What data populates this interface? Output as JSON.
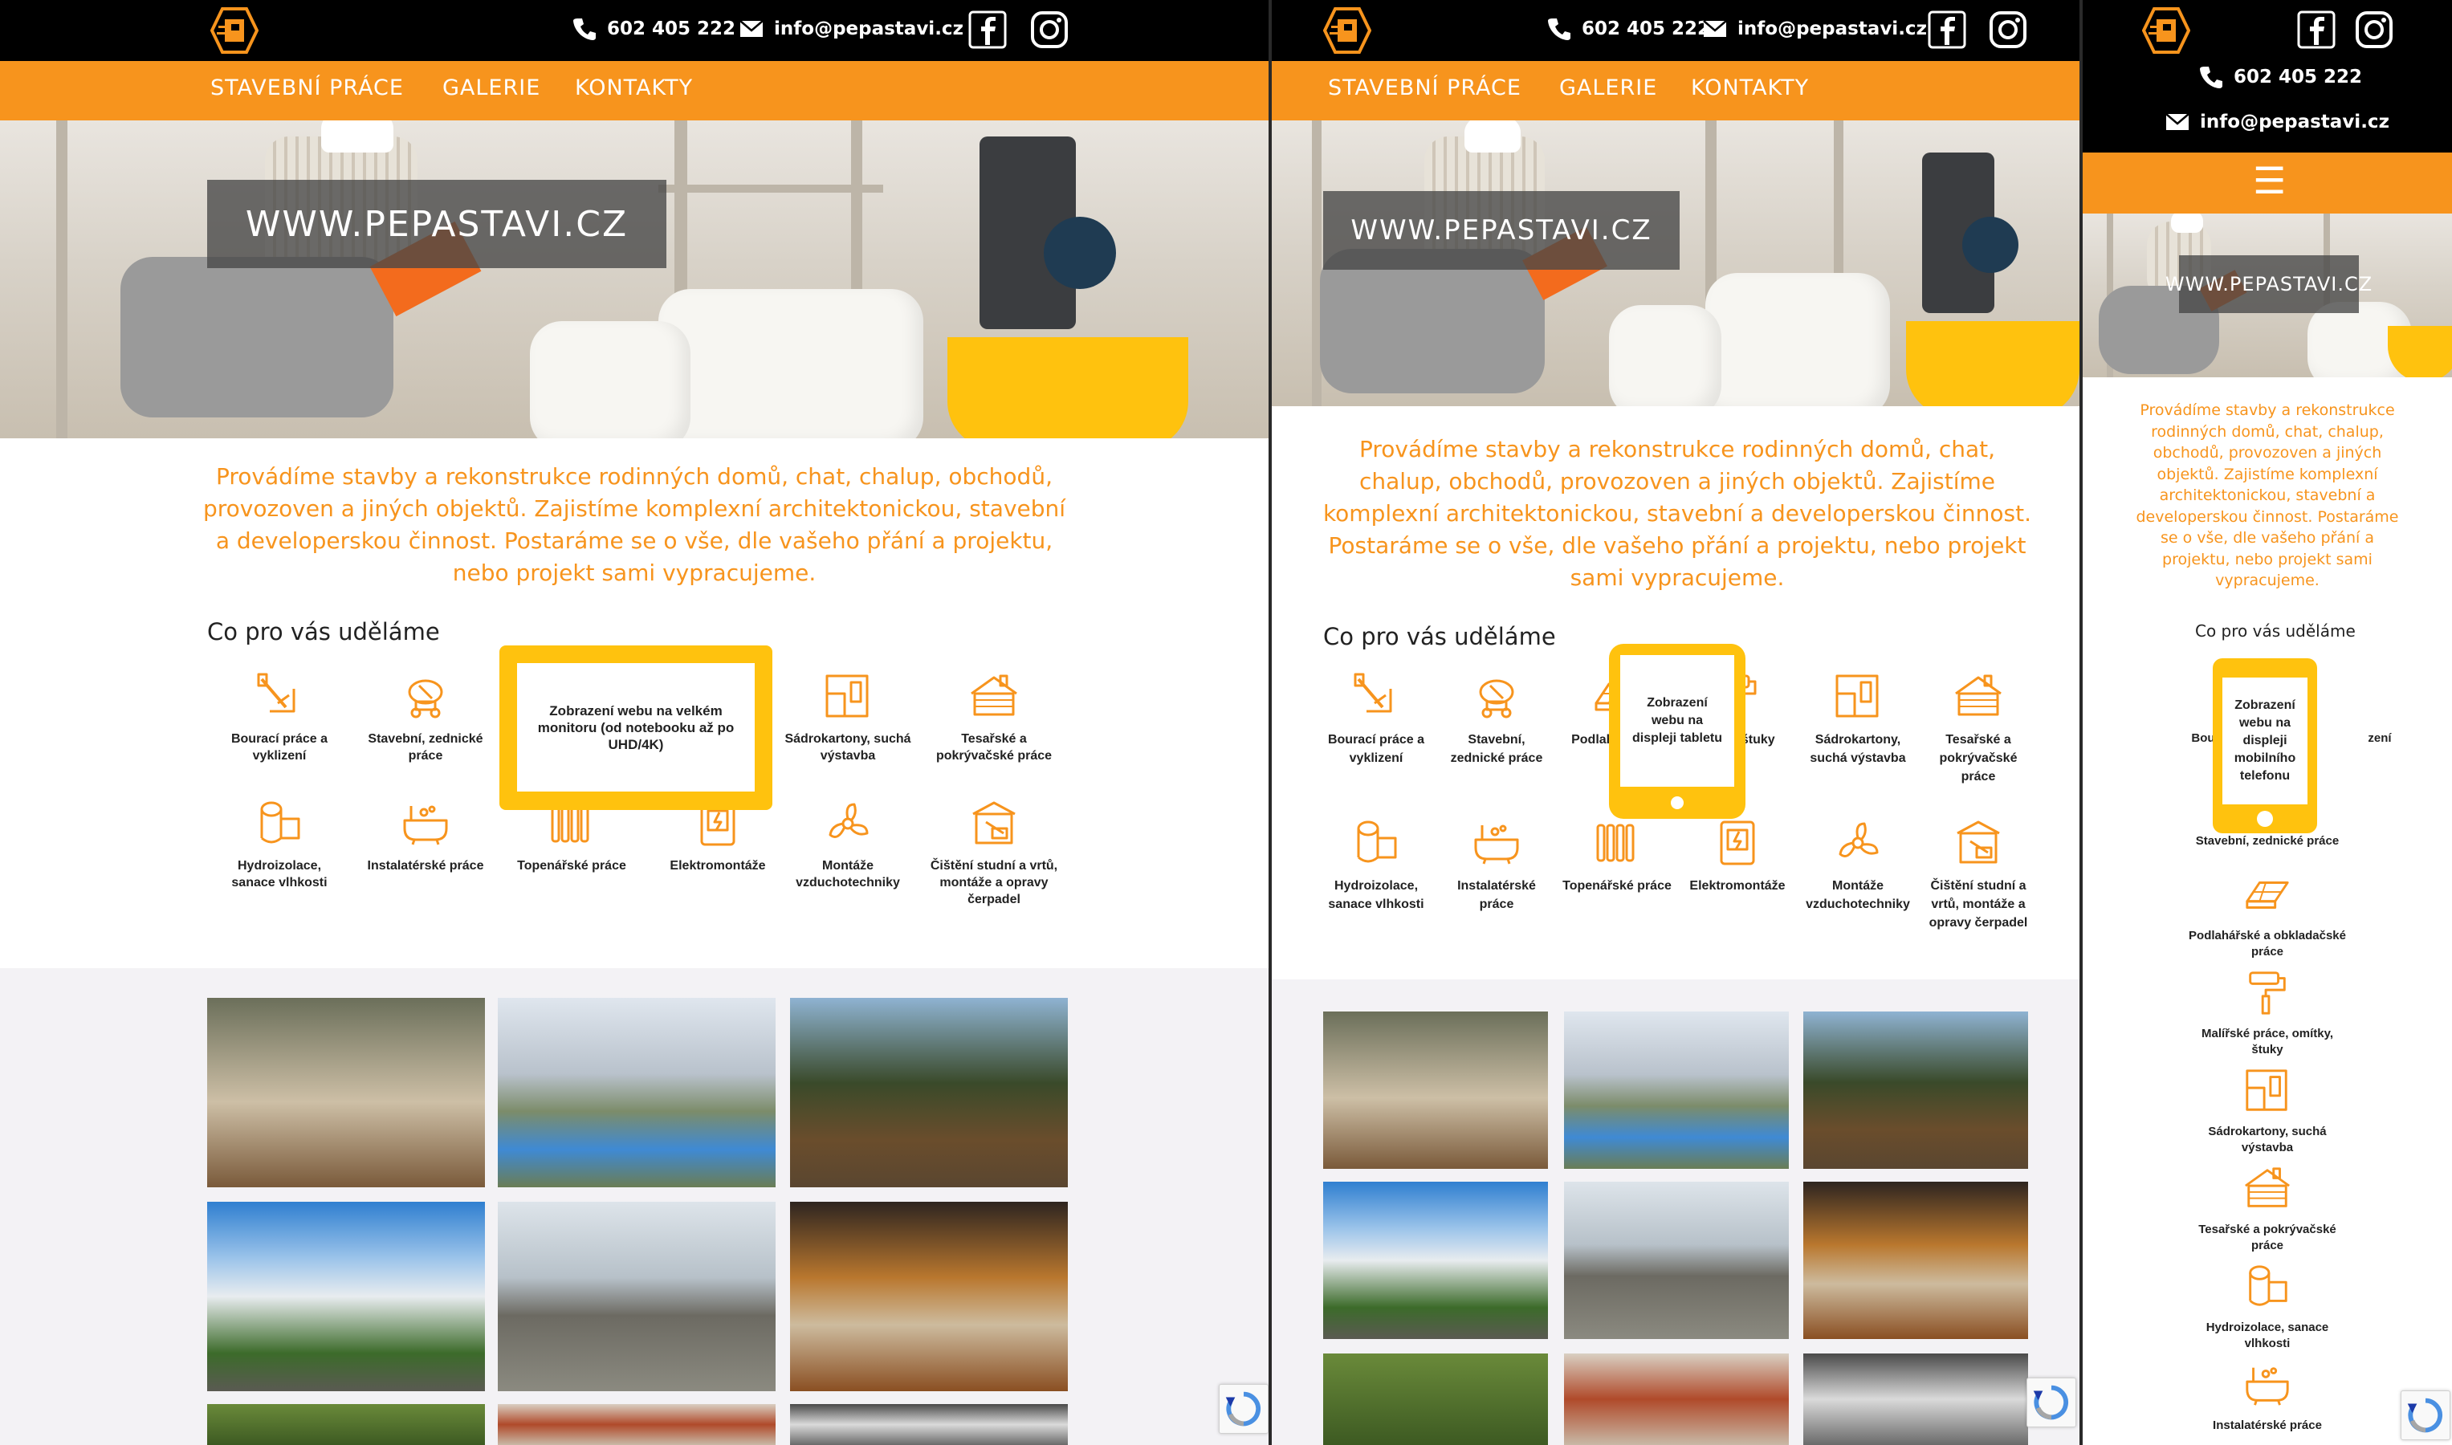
{
  "site": {
    "phone": "602 405 222",
    "email": "info@pepastavi.cz",
    "hero_title": "WWW.PEPASTAVI.CZ",
    "nav": [
      "STAVEBNÍ PRÁCE",
      "GALERIE",
      "KONTAKTY"
    ],
    "intro": "Provádíme stavby a rekonstrukce rodinných domů, chat, chalup, obchodů, provozoven a jiných objektů. Zajistíme komplexní architektonickou, stavební a developerskou činnost. Postaráme se o vše, dle vašeho přání a projektu, nebo projekt sami vypracujeme.",
    "section_title": "Co pro vás uděláme",
    "menu_icon": "☰"
  },
  "colors": {
    "accent": "#f7941d",
    "topbar": "#000000",
    "device": "#ffc20e"
  },
  "devices": {
    "desktop_label": "Zobrazení webu na velkém monitoru (od notebooku až po UHD/4K)",
    "tablet_label": "Zobrazení webu na displeji tabletu",
    "mobile_label": "Zobrazení webu na displeji mobilního telefonu"
  },
  "desktop_services": [
    {
      "label": "Bourací práce a vyklizení",
      "icon": "demolition-icon"
    },
    {
      "label": "Stavební, zednické práce",
      "icon": "mixer-icon"
    },
    {
      "label": "Sádrokartony, suchá výstavba",
      "icon": "drywall-icon"
    },
    {
      "label": "Tesařské a pokrývačské práce",
      "icon": "roof-icon"
    },
    {
      "label": "Hydroizolace, sanace vlhkosti",
      "icon": "roll-icon"
    },
    {
      "label": "Instalatérské práce",
      "icon": "bathtub-icon"
    },
    {
      "label": "Topenářské práce",
      "icon": "radiator-icon"
    },
    {
      "label": "Elektromontáže",
      "icon": "socket-icon"
    },
    {
      "label": "Montáže vzduchotechniky",
      "icon": "fan-icon"
    },
    {
      "label": "Čištění studní a vrtů, montáže a opravy čerpadel",
      "icon": "well-icon"
    }
  ],
  "tablet_services": [
    {
      "label": "Bourací práce a vyklizení",
      "icon": "demolition-icon"
    },
    {
      "label": "Stavební, zednické práce",
      "icon": "mixer-icon"
    },
    {
      "label": "Podlah obkla p",
      "icon": "floor-icon"
    },
    {
      "label": "práce, štuky",
      "icon": "paint-icon"
    },
    {
      "label": "Sádrokartony, suchá výstavba",
      "icon": "drywall-icon"
    },
    {
      "label": "Tesařské a pokrývačské práce",
      "icon": "roof-icon"
    },
    {
      "label": "Hydroizolace, sanace vlhkosti",
      "icon": "roll-icon"
    },
    {
      "label": "Instalatérské práce",
      "icon": "bathtub-icon"
    },
    {
      "label": "Topenářské práce",
      "icon": "radiator-icon"
    },
    {
      "label": "Elektromontáže",
      "icon": "socket-icon"
    },
    {
      "label": "Montáže vzduchotechniky",
      "icon": "fan-icon"
    },
    {
      "label": "Čištění studní a vrtů, montáže a opravy čerpadel",
      "icon": "well-icon"
    }
  ],
  "mobile_services": [
    {
      "label": "Bou",
      "icon": ""
    },
    {
      "label": "zení",
      "icon": ""
    },
    {
      "label": "Stavební, zednické práce",
      "icon": ""
    },
    {
      "label": "Podlahářské a obkladačské práce",
      "icon": "floor-icon"
    },
    {
      "label": "Malířské práce, omítky, štuky",
      "icon": "paint-icon"
    },
    {
      "label": "Sádrokartony, suchá výstavba",
      "icon": "drywall-icon"
    },
    {
      "label": "Tesařské a pokrývačské práce",
      "icon": "roof-icon"
    },
    {
      "label": "Hydroizolace, sanace vlhkosti",
      "icon": "roll-icon"
    },
    {
      "label": "Instalatérské práce",
      "icon": "bathtub-icon"
    }
  ]
}
